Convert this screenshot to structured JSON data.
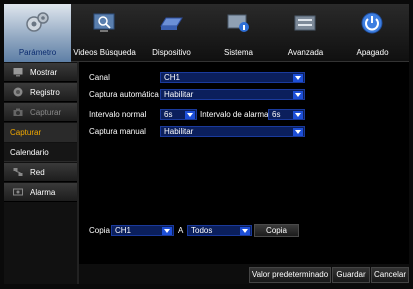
{
  "top_tabs": [
    {
      "label": "Parámetro",
      "icon": "gears-icon"
    },
    {
      "label": "Videos Búsqueda",
      "icon": "monitor-search-icon"
    },
    {
      "label": "Dispositivo",
      "icon": "hard-disk-icon"
    },
    {
      "label": "Sistema",
      "icon": "system-info-icon"
    },
    {
      "label": "Avanzada",
      "icon": "advanced-settings-icon"
    },
    {
      "label": "Apagado",
      "icon": "power-icon"
    }
  ],
  "sidebar": {
    "items": [
      {
        "label": "Mostrar",
        "icon": "display-icon"
      },
      {
        "label": "Registro",
        "icon": "record-icon"
      },
      {
        "label": "Capturar",
        "icon": "camera-icon"
      },
      {
        "label": "Capturar"
      },
      {
        "label": "Calendario"
      },
      {
        "label": "Red",
        "icon": "network-icon"
      },
      {
        "label": "Alarma",
        "icon": "alarm-icon"
      }
    ]
  },
  "form": {
    "canal_label": "Canal",
    "canal_value": "CH1",
    "auto_label": "Captura automática",
    "auto_value": "Habilitar",
    "normal_label": "Intervalo normal",
    "normal_value": "6s",
    "alarm_label": "Intervalo de alarma",
    "alarm_value": "6s",
    "manual_label": "Captura manual",
    "manual_value": "Habilitar"
  },
  "copy": {
    "label": "Copia",
    "from_value": "CH1",
    "to_label": "A",
    "to_value": "Todos",
    "button": "Copia"
  },
  "buttons": {
    "default": "Valor predeterminado",
    "save": "Guardar",
    "cancel": "Cancelar"
  },
  "colors": {
    "accent": "#f2a900",
    "dropdown_bg": "#0b1f5c",
    "active_tab": "#8fa6c0"
  }
}
